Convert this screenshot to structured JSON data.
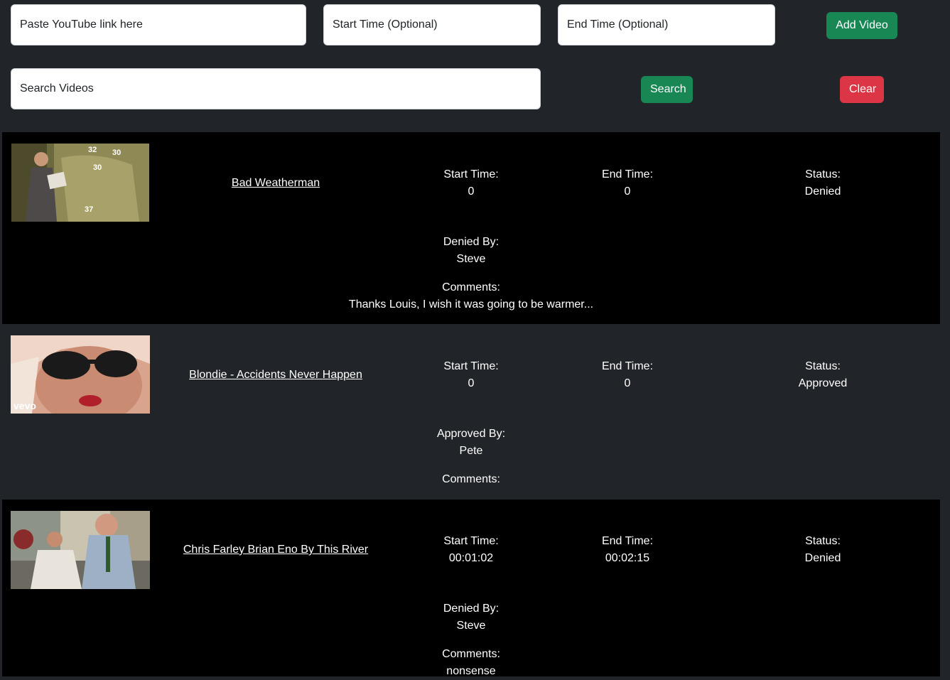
{
  "form": {
    "link_placeholder": "Paste YouTube link here",
    "start_placeholder": "Start Time (Optional)",
    "end_placeholder": "End Time (Optional)",
    "add_label": "Add Video",
    "search_placeholder": "Search Videos",
    "search_label": "Search",
    "clear_label": "Clear"
  },
  "labels": {
    "start": "Start Time:",
    "end": "End Time:",
    "status": "Status:",
    "comments": "Comments:"
  },
  "videos": [
    {
      "title": "Bad Weatherman",
      "start": "0",
      "end": "0",
      "status": "Denied",
      "by_label": "Denied By:",
      "by": "Steve",
      "comment": "Thanks Louis, I wish it was going to be warmer..."
    },
    {
      "title": "Blondie - Accidents Never Happen",
      "start": "0",
      "end": "0",
      "status": "Approved",
      "by_label": "Approved By:",
      "by": "Pete",
      "comment": ""
    },
    {
      "title": "Chris Farley Brian Eno By This River",
      "start": "00:01:02",
      "end": "00:02:15",
      "status": "Denied",
      "by_label": "Denied By:",
      "by": "Steve",
      "comment": "nonsense"
    }
  ],
  "thumb_texts": {
    "weather_numbers": [
      "32",
      "30",
      "30",
      "37"
    ],
    "vevo": "vevo"
  },
  "colors": {
    "page_bg": "#212529",
    "row_dark": "#000000",
    "success": "#198754",
    "danger": "#dc3545"
  }
}
